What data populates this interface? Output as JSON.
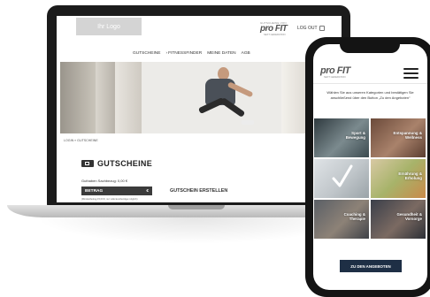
{
  "laptop": {
    "logo": "Ihr Logo",
    "brand": {
      "top": "GUTSCHEINE VON",
      "main": "pro FIT",
      "sub": "NEXT GENERATION"
    },
    "logout": "LOG OUT",
    "nav": [
      "GUTSCHEINE",
      "FITNESSFINDER",
      "MEINE DATEN",
      "AGB"
    ],
    "breadcrumb": "LOGIN  »  GUTSCHEINE",
    "title": "GUTSCHEINE",
    "balance": "Guthaben Sachbezug: 0,00 €",
    "amount_label": "BETRAG",
    "amount_currency": "€",
    "note": "(Mindestbetrag 15,00 €, nur volle Eurobeträge möglich)",
    "create_label": "GUTSCHEIN ERSTELLEN"
  },
  "phone": {
    "brand": {
      "main": "pro FIT",
      "sub": "NEXT GENERATION"
    },
    "intro": "Wählen Sie aus unseren Kategorien und bestätigen Sie anschließend über den Button „Zu den Angeboten“",
    "tiles": [
      {
        "label": "Sport &\nBewegung"
      },
      {
        "label": "Entspannung &\nWellness"
      },
      {
        "label": ""
      },
      {
        "label": "Ernährung &\nErholung"
      },
      {
        "label": "Coaching &\nTherapie"
      },
      {
        "label": "Gesundheit &\nVorsorge"
      }
    ],
    "cta": "ZU DEN ANGEBOTEN"
  },
  "colors": {
    "navy": "#1e2f45",
    "dark": "#3b3b3b"
  }
}
